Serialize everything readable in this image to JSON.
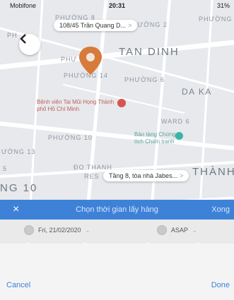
{
  "status_bar": {
    "carrier": "Mobifone",
    "time": "20:31",
    "battery": "31%"
  },
  "map": {
    "pickup_bubble": "108/45 Trần Quang D...",
    "dropoff_bubble": "Tầng 8, tòa nhà Jabes...",
    "labels": {
      "phuong8": "PHƯỜNG 8",
      "phuong2": "PHƯỜNG 2",
      "phuong_left": "PH",
      "phuong_right": "PHƯỜNG",
      "phuong_mid": "PHƯ",
      "tan_dinh": "TAN DINH",
      "phuong14": "PHƯỜNG 14",
      "phuong6": "PHƯỜNG 6",
      "da_ka": "DA KA",
      "ward6": "WARD 6",
      "phuong10": "PHƯỜNG 10",
      "phuong13": "ƯỜNG 13",
      "do_thanh": "ĐO THANH",
      "res": "RES",
      "thanh": "THÀNH",
      "ng10": "NG 10",
      "five": "5"
    },
    "hospital": "Bệnh viện Tai Mũi Họng Thành phố Hồ Chí Minh",
    "museum": "Bảo tàng Chứng tích Chiến tranh"
  },
  "picker": {
    "close_icon": "×",
    "title": "Chọn thời gian lấy hàng",
    "done_partial": "Xong",
    "date_value": "Fri, 21/02/2020",
    "time_value": "ASAP"
  },
  "footer": {
    "cancel": "Cancel",
    "done": "Done"
  },
  "colors": {
    "accent": "#3e82d8",
    "pin": "#d77a3a"
  }
}
